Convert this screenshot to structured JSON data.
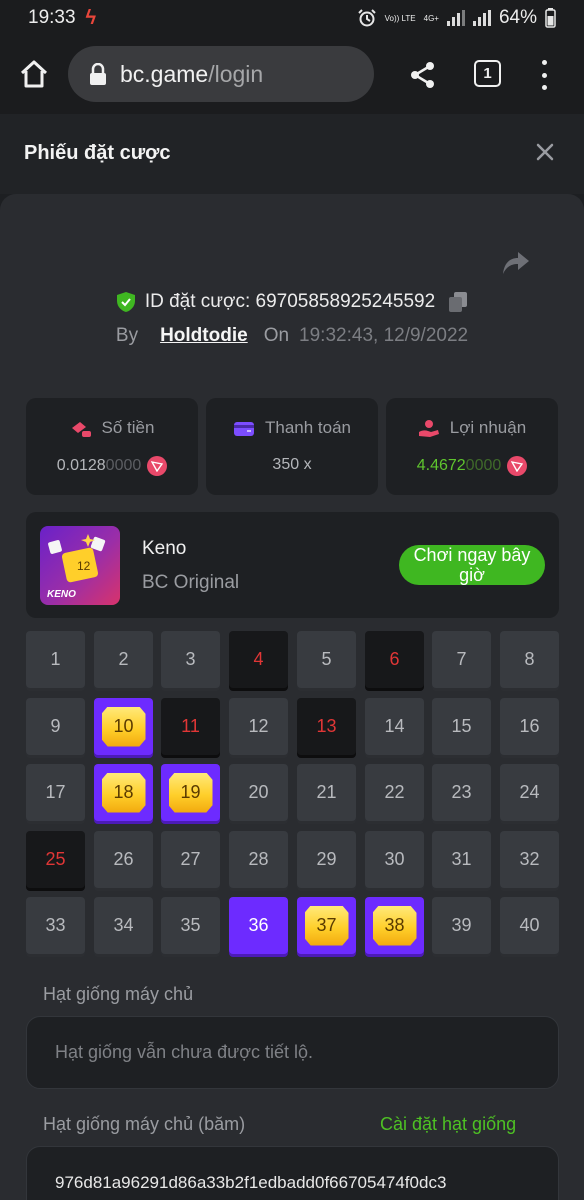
{
  "status_bar": {
    "time": "19:33",
    "network_top": "Vo)) LTE",
    "network_4g": "4G+",
    "battery": "64%"
  },
  "browser": {
    "url_host": "bc.game",
    "url_path": "/login",
    "tab_count": "1"
  },
  "modal": {
    "title": "Phiếu đặt cược"
  },
  "bet": {
    "id_label": "ID đặt cược:",
    "id_value": "69705858925245592",
    "by_label": "By",
    "user": "Holdtodie",
    "on_label": "On",
    "timestamp": "19:32:43, 12/9/2022"
  },
  "stats": [
    {
      "label": "Số tiền",
      "value_main": "0.0128",
      "value_dim": "0000",
      "icon": "coins-icon"
    },
    {
      "label": "Thanh toán",
      "value_main": "350 x",
      "value_dim": "",
      "icon": "wallet-icon"
    },
    {
      "label": "Lợi nhuận",
      "value_main": "4.4672",
      "value_dim": "0000",
      "icon": "profit-hand-icon"
    }
  ],
  "game": {
    "name": "Keno",
    "provider": "BC Original",
    "thumb_label": "KENO",
    "thumb_tile": "12",
    "play_label": "Chơi ngay bây giờ"
  },
  "keno": {
    "numbers": [
      "1",
      "2",
      "3",
      "4",
      "5",
      "6",
      "7",
      "8",
      "9",
      "10",
      "11",
      "12",
      "13",
      "14",
      "15",
      "16",
      "17",
      "18",
      "19",
      "20",
      "21",
      "22",
      "23",
      "24",
      "25",
      "26",
      "27",
      "28",
      "29",
      "30",
      "31",
      "32",
      "33",
      "34",
      "35",
      "36",
      "37",
      "38",
      "39",
      "40"
    ],
    "drawn_missed": [
      4,
      6,
      11,
      13,
      25
    ],
    "picked_hit": [
      10,
      18,
      19,
      37,
      38
    ],
    "picked_missed": [
      36
    ]
  },
  "seeds": {
    "server_seed_label": "Hạt giống máy chủ",
    "server_seed_placeholder": "Hạt giống vẫn chưa được tiết lộ.",
    "server_hash_label": "Hạt giống máy chủ (băm)",
    "set_seed_link": "Cài đặt hạt giống",
    "server_hash_value": "976d81a96291d86a33b2f1edbadd0f66705474f0dc3"
  },
  "colors": {
    "accent_purple": "#6d2bff",
    "gem_gold": "#ffcf2a",
    "green": "#3fb721",
    "miss_red": "#e03636"
  }
}
